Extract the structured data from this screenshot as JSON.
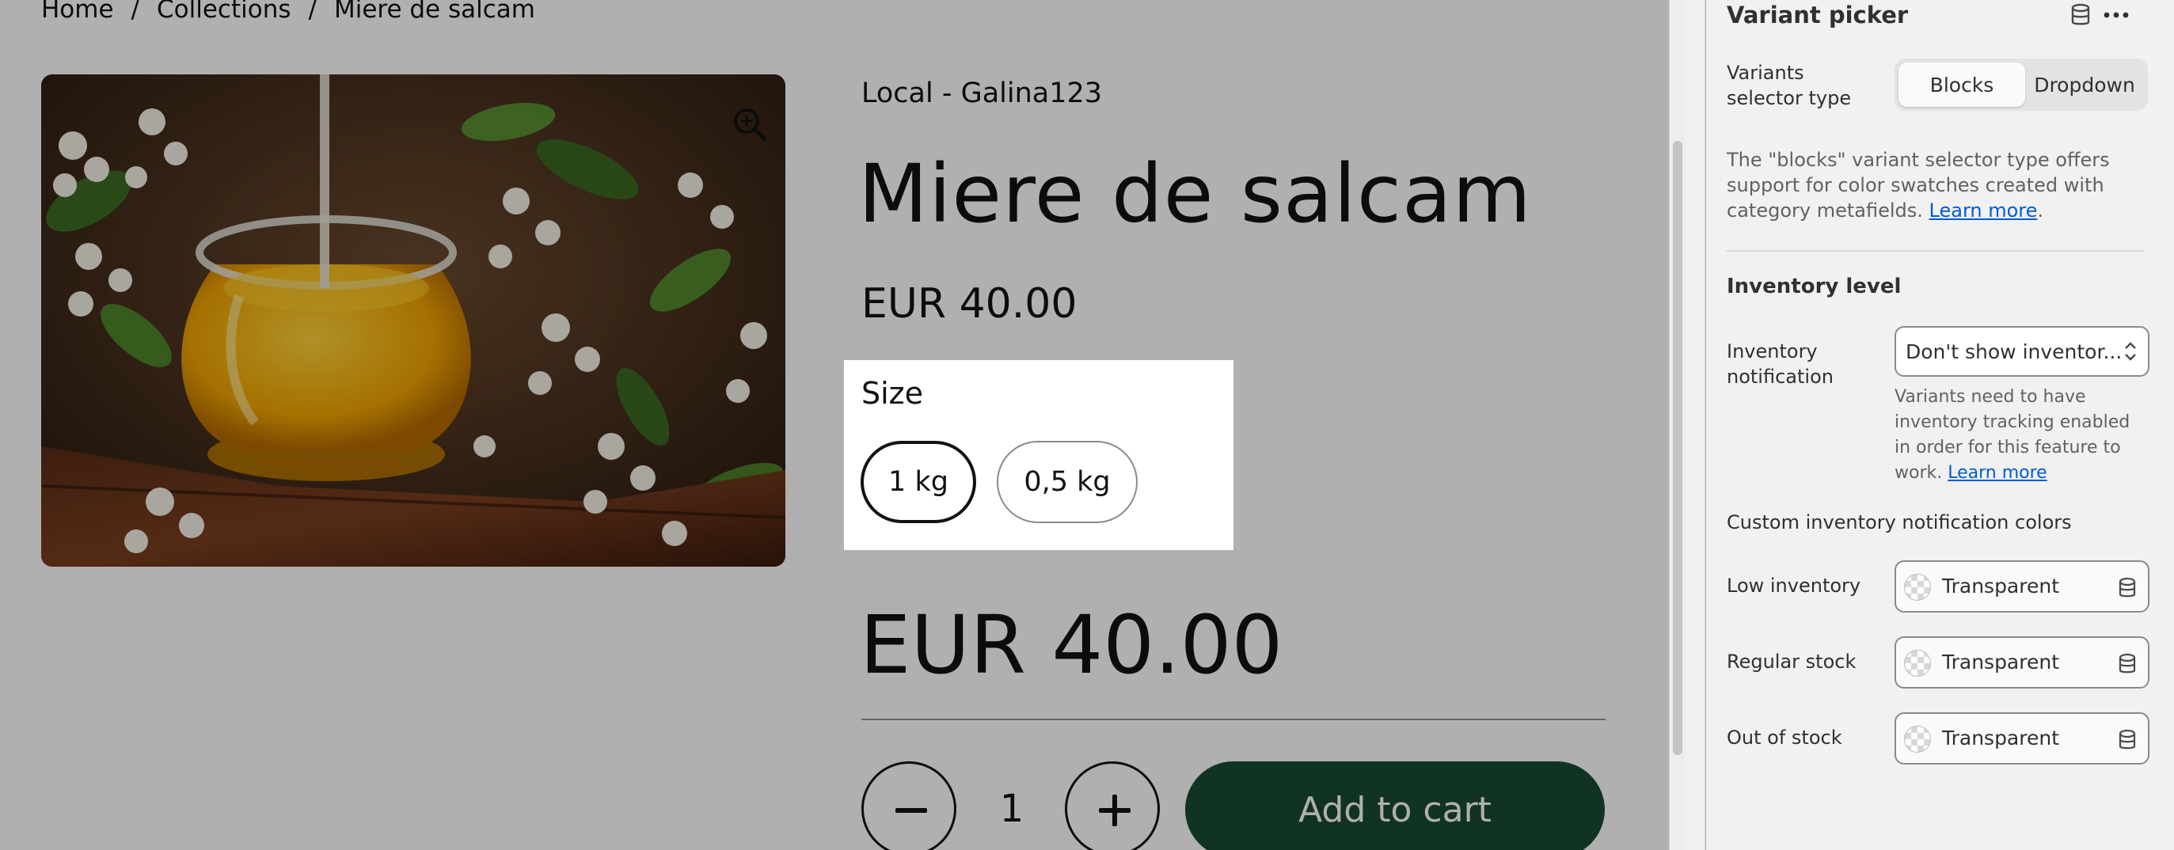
{
  "breadcrumb": {
    "home": "Home",
    "collections": "Collections",
    "current": "Miere de salcam",
    "separator": "/"
  },
  "product": {
    "vendor": "Local - Galina123",
    "title": "Miere de salcam",
    "price": "EUR 40.00",
    "price_large": "EUR 40.00",
    "size_label": "Size",
    "sizes": [
      "1 kg",
      "0,5 kg"
    ],
    "selected_size": "1 kg",
    "quantity": "1",
    "add_to_cart": "Add to cart",
    "image_alt": "jar of acacia honey with white acacia flowers",
    "zoom_icon": "zoom-in-icon"
  },
  "panel": {
    "heading": "Variant picker",
    "selector_type_label": "Variants selector type",
    "selector_options": [
      "Blocks",
      "Dropdown"
    ],
    "selector_selected": "Blocks",
    "description": "The \"blocks\" variant selector type offers support for color swatches created with category metafields.",
    "description_link": "Learn more",
    "inventory_section": "Inventory level",
    "inventory_notification_label": "Inventory notification",
    "inventory_notification_value": "Don't show inventor...",
    "inventory_help": "Variants need to have inventory tracking enabled in order for this feature to work.",
    "inventory_help_link": "Learn more",
    "custom_colors_label": "Custom inventory notification colors",
    "color_settings": [
      {
        "label": "Low inventory",
        "value": "Transparent"
      },
      {
        "label": "Regular stock",
        "value": "Transparent"
      },
      {
        "label": "Out of stock",
        "value": "Transparent"
      }
    ]
  },
  "colors": {
    "accent_button": "#1a4a30",
    "link": "#005bd3",
    "overlay": "rgba(0,0,0,0.31)"
  }
}
